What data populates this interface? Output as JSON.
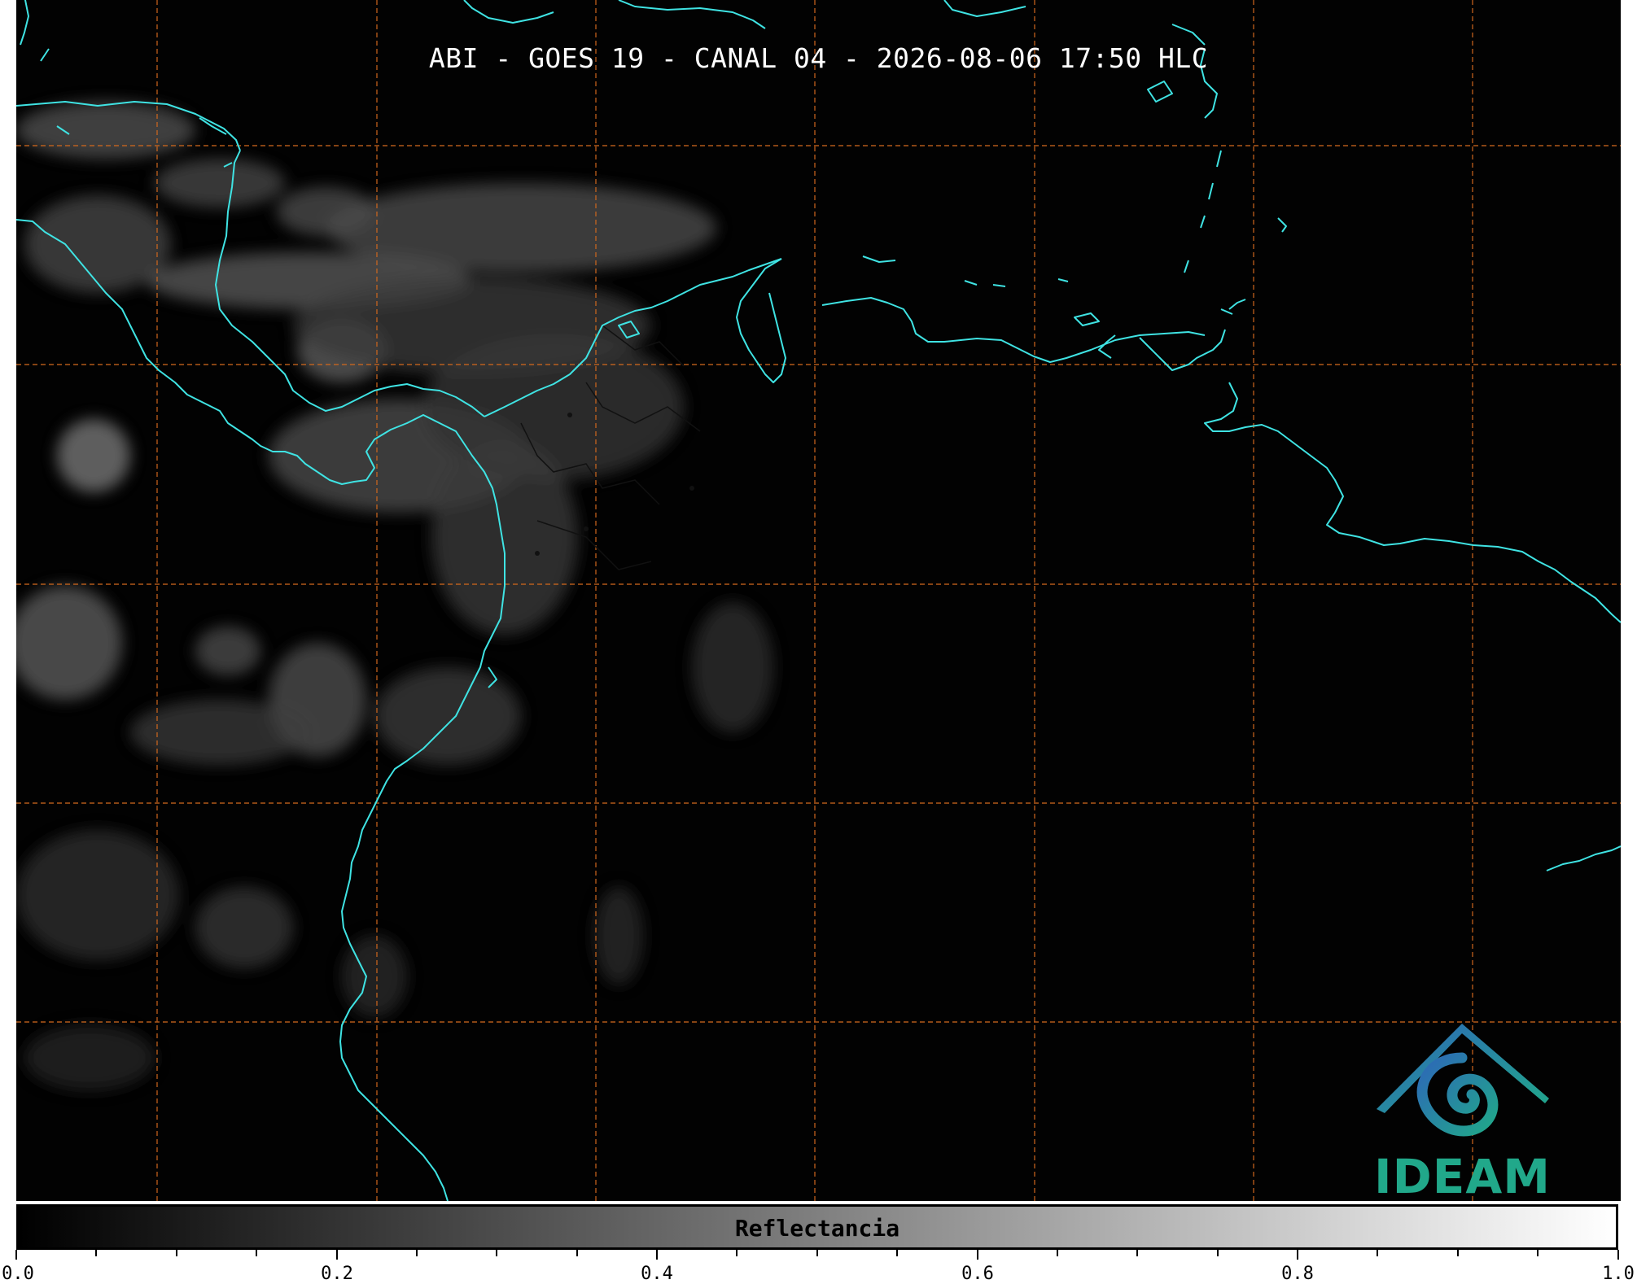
{
  "title": "ABI - GOES 19 - CANAL 04 - 2026-08-06 17:50 HLC",
  "colorbar": {
    "label": "Reflectancia",
    "range": [
      0.0,
      1.0
    ],
    "tick_labels": [
      "0.0",
      "0.2",
      "0.4",
      "0.6",
      "0.8",
      "1.0"
    ]
  },
  "logo": {
    "text": "IDEAM",
    "color": "#21a88a"
  },
  "colors": {
    "background": "#020202",
    "coastline": "#3fe3e3",
    "gridline": "#d2691e",
    "borders": "#111111"
  }
}
